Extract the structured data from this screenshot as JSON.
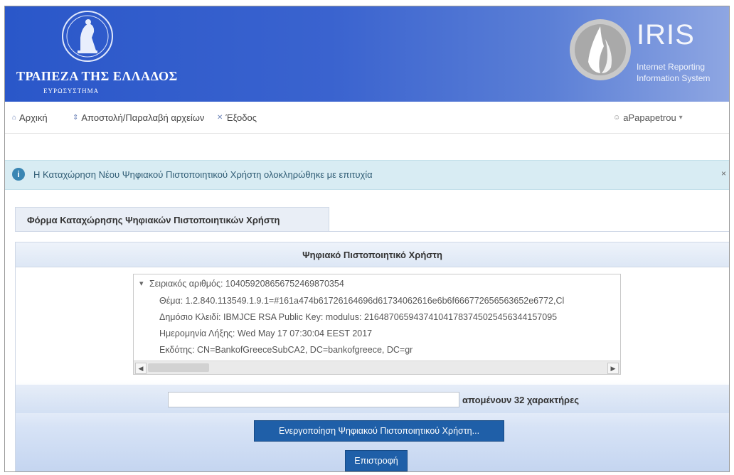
{
  "banner": {
    "bank_name": "ΤΡΑΠΕΖΑ ΤΗΣ ΕΛΛΑΔΟΣ",
    "bank_sub": "ΕΥΡΩΣΥΣΤΗΜΑ",
    "app_name": "IRIS",
    "app_sub1": "Internet Reporting",
    "app_sub2": "Information System"
  },
  "nav": {
    "home": {
      "label": "Αρχική",
      "icon": "home-icon"
    },
    "files": {
      "label": "Αποστολή/Παραλαβή αρχείων",
      "icon": "transfer-icon"
    },
    "logout": {
      "label": "Έξοδος",
      "icon": "close-icon"
    },
    "user": {
      "label": "aPapapetrou",
      "icon": "user-icon",
      "caret": "▾"
    }
  },
  "alert": {
    "message": "Η Καταχώρηση Νέου Ψηφιακού Πιστοποιητικού Χρήστη ολοκληρώθηκε με επιτυχία",
    "icon": "info-icon",
    "close": "×"
  },
  "form": {
    "tab_label": "Φόρμα Καταχώρησης Ψηφιακών Πιστοποιητικών Χρήστη"
  },
  "certificate": {
    "panel_title": "Ψηφιακό Πιστοποιητικό Χρήστη",
    "serial": "Σειριακός αριθμός: 104059208656752469870354",
    "subject": "Θέμα: 1.2.840.113549.1.9.1=#161a474b61726164696d61734062616e6b6f666772656563652e6772,Cl",
    "public_key": "Δημόσιο Κλειδί: IBMJCE RSA Public Key: modulus: 216487065943741041783745025456344157095",
    "expiry": "Ημερομηνία Λήξης: Wed May 17 07:30:04 EEST 2017",
    "issuer": "Εκδότης: CN=BankofGreeceSubCA2, DC=bankofgreece, DC=gr"
  },
  "char_input": {
    "value": "",
    "remaining": "απομένουν 32 χαρακτήρες"
  },
  "buttons": {
    "activate": "Ενεργοποίηση Ψηφιακού Πιστοποιητικού Χρήστη...",
    "back": "Επιστροφή"
  }
}
